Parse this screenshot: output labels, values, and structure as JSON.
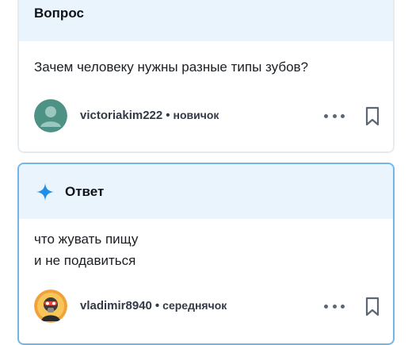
{
  "question": {
    "header_title": "Вопрос",
    "text": "Зачем человеку нужны разные типы зубов?",
    "author": {
      "username": "victoriakim222",
      "separator": "•",
      "rank": "новичок"
    },
    "icons": {
      "more": "more-dots-icon",
      "bookmark": "bookmark-icon",
      "avatar": "default-user-avatar"
    }
  },
  "answer": {
    "header_title": "Ответ",
    "text_line1": "что жувать пищу",
    "text_line2": "и не подавиться",
    "author": {
      "username": "vladimir8940",
      "separator": "•",
      "rank": "середнячок"
    },
    "icons": {
      "header": "sparkle-icon",
      "more": "more-dots-icon",
      "bookmark": "bookmark-icon",
      "avatar": "masked-character-avatar"
    }
  },
  "colors": {
    "header_bg": "#eaf4fc",
    "answer_border": "#72b6e8",
    "question_border": "#e6ebf0",
    "sparkle": "#1f8ee8",
    "default_avatar": "#4e9185"
  }
}
